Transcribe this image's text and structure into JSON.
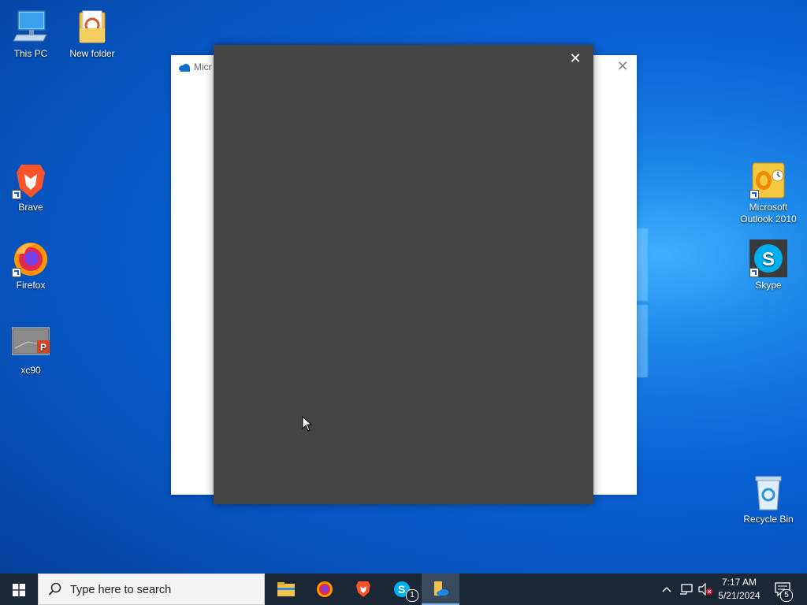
{
  "desktop_icons": {
    "this_pc": "This PC",
    "new_folder": "New folder",
    "brave": "Brave",
    "firefox": "Firefox",
    "xc90": "xc90",
    "outlook_line1": "Microsoft",
    "outlook_line2": "Outlook 2010",
    "skype": "Skype",
    "recycle_bin": "Recycle Bin"
  },
  "onedrive_window": {
    "title": "Micr",
    "close_glyph": "✕"
  },
  "dark_dialog": {
    "close_glyph": "✕"
  },
  "taskbar": {
    "search_placeholder": "Type here to search",
    "skype_badge": "1",
    "notification_badge": "5",
    "time": "7:17 AM",
    "date": "5/21/2024"
  },
  "icons": [
    "windows-logo-icon",
    "search-icon",
    "file-explorer-icon",
    "firefox-icon",
    "brave-icon",
    "skype-icon",
    "onedrive-icon",
    "chevron-up-icon",
    "network-icon",
    "volume-muted-icon",
    "notification-icon"
  ],
  "colors": {
    "taskbar": "#1c2736",
    "dialog": "#444444",
    "desktop": "#0b63d6"
  }
}
